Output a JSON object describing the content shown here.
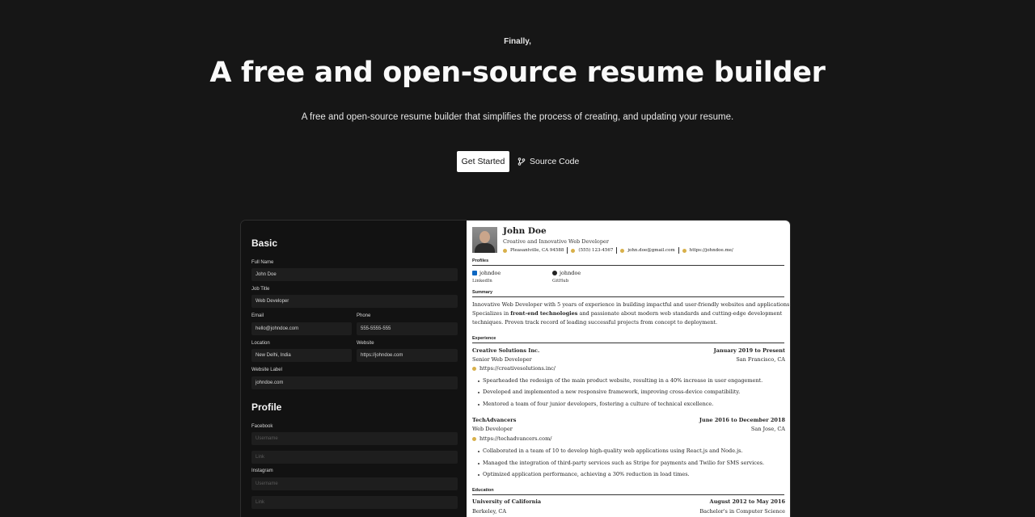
{
  "hero": {
    "eyebrow": "Finally,",
    "title": "A free and open-source resume builder",
    "subtitle": "A free and open-source resume builder that simplifies the process of creating, and updating your resume.",
    "get_started": "Get Started",
    "source_code": "Source Code"
  },
  "editor": {
    "basic_title": "Basic",
    "full_name_label": "Full Name",
    "full_name_value": "John Doe",
    "job_title_label": "Job Title",
    "job_title_value": "Web Developer",
    "email_label": "Email",
    "email_value": "hello@johndoe.com",
    "phone_label": "Phone",
    "phone_value": "555-5555-555",
    "location_label": "Location",
    "location_value": "New Delhi, India",
    "website_label": "Website",
    "website_value": "https://johndoe.com",
    "website_label_label": "Website Label",
    "website_label_value": "johndoe.com",
    "profile_title": "Profile",
    "facebook_label": "Facebook",
    "facebook_username_placeholder": "Username",
    "facebook_link_placeholder": "Link",
    "instagram_label": "Instagram",
    "instagram_username_placeholder": "Username",
    "instagram_link_placeholder": "Link"
  },
  "resume": {
    "name": "John Doe",
    "headline": "Creative and Innovative Web Developer",
    "location": "Pleasantville, CA 94588",
    "phone": "(555) 123-4567",
    "email": "john.doe@gmail.com",
    "website": "https://johndoe.me/",
    "profiles_heading": "Profiles",
    "profiles": [
      {
        "username": "johndoe",
        "network": "LinkedIn"
      },
      {
        "username": "johndoe",
        "network": "GitHub"
      }
    ],
    "summary_heading": "Summary",
    "summary_lines": [
      "Innovative Web Developer with 5 years of experience in building impactful and user-friendly websites and applications.",
      "Specializes in",
      "front-end technologies",
      "and passionate about modern web standards and cutting-edge development",
      "techniques. Proven track record of leading successful projects from concept to deployment."
    ],
    "experience_heading": "Experience",
    "experience": [
      {
        "company": "Creative Solutions Inc.",
        "dates": "January 2019 to Present",
        "role": "Senior Web Developer",
        "location": "San Francisco, CA",
        "url": "https://creativesolutions.inc/",
        "bullets": [
          "Spearheaded the redesign of the main product website, resulting in a 40% increase in user engagement.",
          "Developed and implemented a new responsive framework, improving cross-device compatibility.",
          "Mentored a team of four junior developers, fostering a culture of technical excellence."
        ]
      },
      {
        "company": "TechAdvancers",
        "dates": "June 2016 to December 2018",
        "role": "Web Developer",
        "location": "San Jose, CA",
        "url": "https://techadvancers.com/",
        "bullets": [
          "Collaborated in a team of 10 to develop high-quality web applications using React.js and Node.js.",
          "Managed the integration of third-party services such as Stripe for payments and Twilio for SMS services.",
          "Optimized application performance, achieving a 30% reduction in load times."
        ]
      }
    ],
    "education_heading": "Education",
    "education": {
      "school": "University of California",
      "dates": "August 2012 to May 2016",
      "location": "Berkeley, CA",
      "degree": "Bachelor's in Computer Science"
    }
  }
}
